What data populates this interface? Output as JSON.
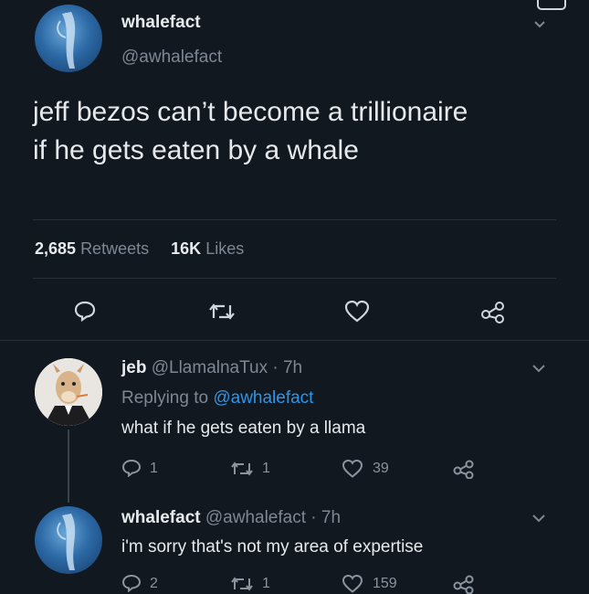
{
  "main_tweet": {
    "display_name": "whalefact",
    "handle": "@awhalefact",
    "text_line1": "jeff bezos can’t become a trillionaire",
    "text_line2": "if he gets eaten by a whale",
    "retweets_count": "2,685",
    "retweets_label": "Retweets",
    "likes_count": "16K",
    "likes_label": "Likes"
  },
  "replies": [
    {
      "display_name": "jeb",
      "handle_time": "@LlamalnaTux · 7h",
      "replying_prefix": "Replying to",
      "replying_to": "@awhalefact",
      "text": "what if he gets eaten by a llama",
      "replies": "1",
      "retweets": "1",
      "likes": "39"
    },
    {
      "display_name": "whalefact",
      "handle_time": "@awhalefact · 7h",
      "text": "i'm sorry that's not my area of expertise",
      "replies": "2",
      "retweets": "1",
      "likes": "159"
    }
  ],
  "colors": {
    "background": "#121820",
    "accent_link": "#2d95e8",
    "text": "#d9dde2",
    "muted": "#7d8893"
  }
}
